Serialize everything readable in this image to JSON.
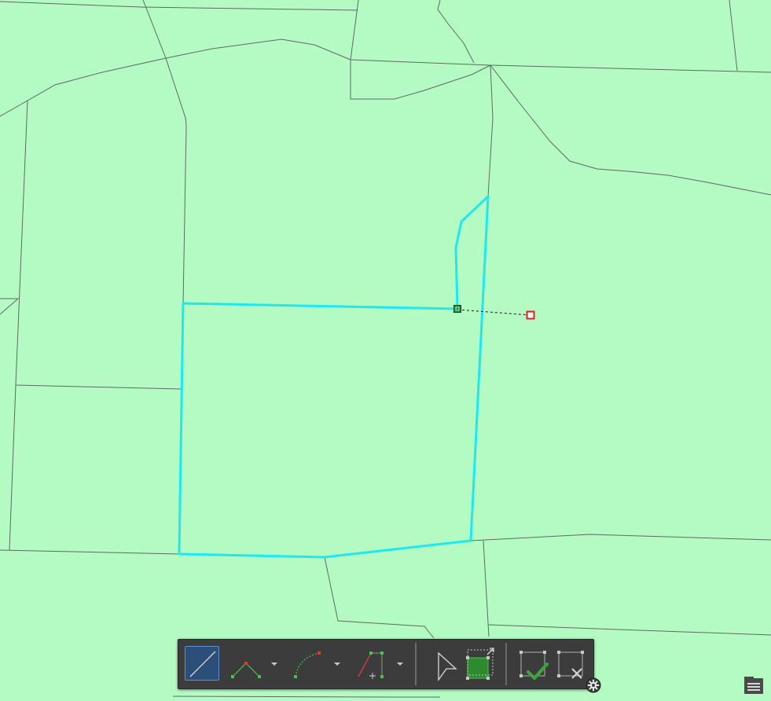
{
  "map": {
    "background_color": "#b3fac3",
    "parcel_line_color": "#5f6b62",
    "sketch_color": "#20e8f0",
    "active_vertex_color": "#1f8a3c",
    "cursor_vertex_color": "#e02020"
  },
  "toolbar": {
    "buttons": [
      {
        "icon": "line-segment-icon",
        "active": true
      },
      {
        "icon": "midpoint-vertex-icon",
        "has_dropdown": true
      },
      {
        "icon": "arc-segment-icon",
        "has_dropdown": true
      },
      {
        "icon": "right-angle-icon",
        "has_dropdown": true
      },
      {
        "icon": "select-arrow-icon"
      },
      {
        "icon": "stretch-feature-icon"
      },
      {
        "icon": "finish-sketch-icon"
      },
      {
        "icon": "cancel-sketch-icon"
      }
    ],
    "active_color": "#2b4f79",
    "finish_color": "#3aa53a"
  },
  "overlay": {
    "settings_icon": "gear-icon",
    "layer_list_icon": "layer-list-icon"
  }
}
